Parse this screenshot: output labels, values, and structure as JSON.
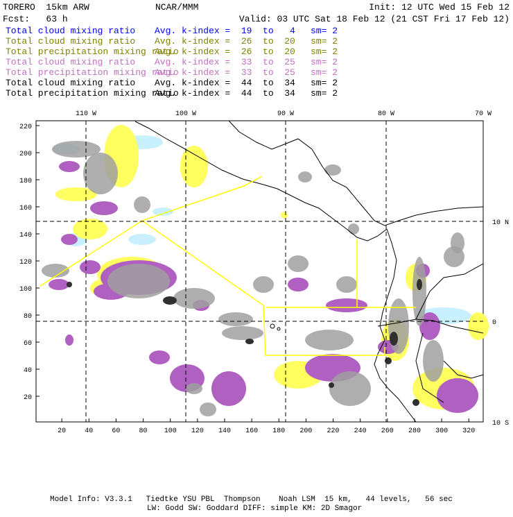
{
  "header": {
    "model": "TORERO  15km ARW",
    "org": "NCAR/MMM",
    "init": "Init: 12 UTC Wed 15 Feb 12",
    "fcst": "Fcst:   63 h",
    "valid": "Valid: 03 UTC Sat 18 Feb 12 (21 CST Fri 17 Feb 12)"
  },
  "legend": [
    {
      "field": "Total cloud mixing ratio",
      "range": "Avg. k-index =  19  to   4",
      "sm": "sm= 2",
      "color": "#0000ff"
    },
    {
      "field": "Total cloud mixing ratio",
      "range": "Avg. k-index =  26  to  20",
      "sm": "sm= 2",
      "color": "#808000"
    },
    {
      "field": "Total precipitation mixing ratio",
      "range": "Avg. k-index =  26  to  20",
      "sm": "sm= 2",
      "color": "#808000"
    },
    {
      "field": "Total cloud mixing ratio",
      "range": "Avg. k-index =  33  to  25",
      "sm": "sm= 2",
      "color": "#c070c0"
    },
    {
      "field": "Total precipitation mixing ratio",
      "range": "Avg. k-index =  33  to  25",
      "sm": "sm= 2",
      "color": "#c070c0"
    },
    {
      "field": "Total cloud mixing ratio",
      "range": "Avg. k-index =  44  to  34",
      "sm": "sm= 2",
      "color": "#000000"
    },
    {
      "field": "Total precipitation mixing ratio",
      "range": "Avg. k-index =  44  to  34",
      "sm": "sm= 2",
      "color": "#000000"
    }
  ],
  "axes": {
    "y_ticks": [
      "20",
      "40",
      "60",
      "80",
      "100",
      "120",
      "140",
      "160",
      "180",
      "200",
      "220"
    ],
    "x_ticks": [
      "20",
      "40",
      "60",
      "80",
      "100",
      "120",
      "140",
      "160",
      "180",
      "200",
      "220",
      "240",
      "260",
      "280",
      "300",
      "320"
    ],
    "lon_labels": [
      "110 W",
      "100 W",
      "90 W",
      "80 W",
      "70 W"
    ],
    "lat_labels": [
      "10 N",
      "0",
      "10 S"
    ]
  },
  "footer": {
    "line1": "Model Info: V3.3.1   Tiedtke YSU PBL  Thompson    Noah LSM  15 km,   44 levels,   56 sec",
    "line2": "LW: Godd SW: Goddard DIFF: simple KM: 2D Smagor"
  },
  "colors": {
    "track": "#ffff00",
    "light_blue": "#c8f0ff",
    "yellow": "#ffff60",
    "magenta": "#b060c0",
    "gray": "#a0a0a0",
    "dark": "#303030"
  }
}
